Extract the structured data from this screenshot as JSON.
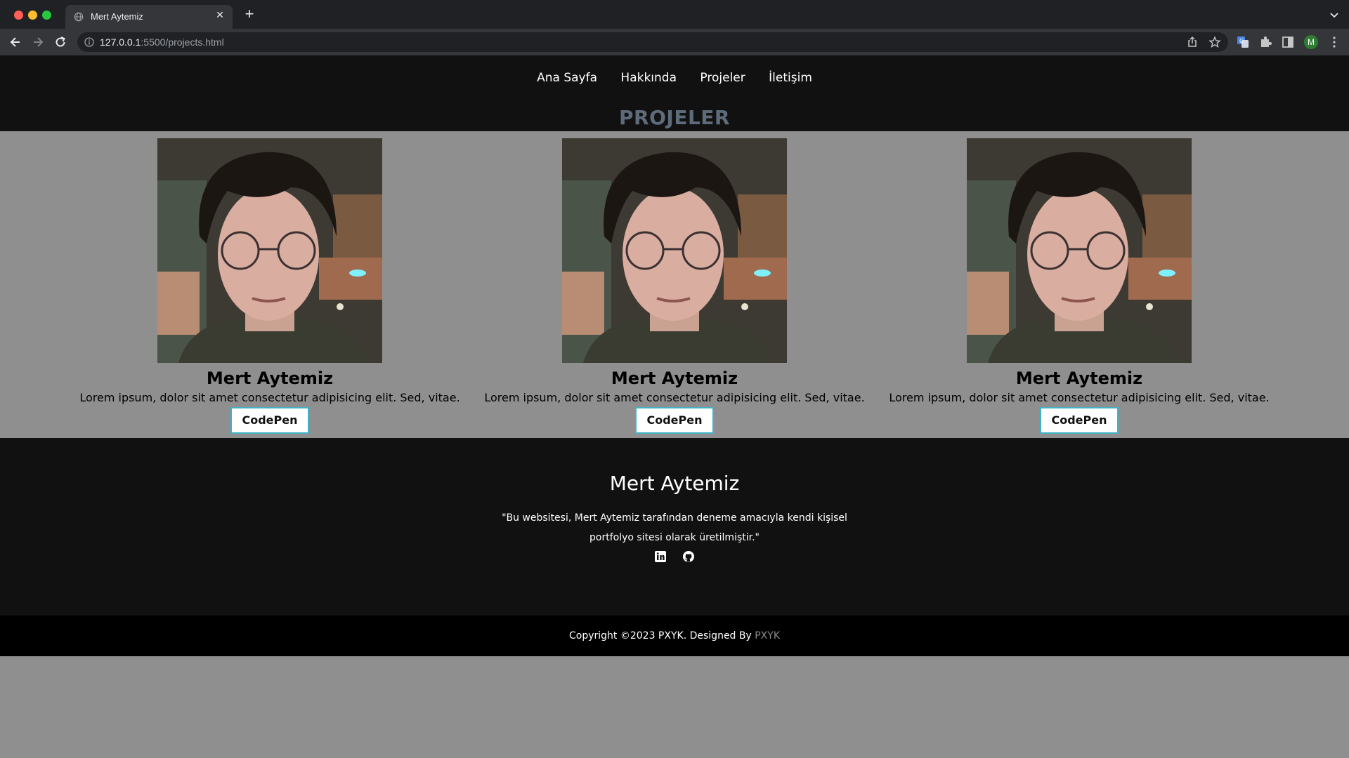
{
  "browser": {
    "tab_title": "Mert Aytemiz",
    "url_host": "127.0.0.1",
    "url_path": ":5500/projects.html",
    "avatar_letter": "M",
    "new_tab_symbol": "+",
    "close_symbol": "✕"
  },
  "site": {
    "nav": [
      "Ana Sayfa",
      "Hakkında",
      "Projeler",
      "İletişim"
    ],
    "page_title": "PROJELER",
    "projects": [
      {
        "title": "Mert Aytemiz",
        "text": "Lorem ipsum, dolor sit amet consectetur adipisicing elit. Sed, vitae.",
        "button": "CodePen"
      },
      {
        "title": "Mert Aytemiz",
        "text": "Lorem ipsum, dolor sit amet consectetur adipisicing elit. Sed, vitae.",
        "button": "CodePen"
      },
      {
        "title": "Mert Aytemiz",
        "text": "Lorem ipsum, dolor sit amet consectetur adipisicing elit. Sed, vitae.",
        "button": "CodePen"
      }
    ],
    "footer": {
      "name": "Mert Aytemiz",
      "description": "\"Bu websitesi, Mert Aytemiz tarafından deneme amacıyla kendi kişisel portfolyo sitesi olarak üretilmiştir.\"",
      "socials": [
        "linkedin-icon",
        "github-icon"
      ]
    },
    "copyright": {
      "text": "Copyright ©2023 PXYK. Designed By ",
      "brand": "PXYK"
    }
  },
  "colors": {
    "page_bg": "#8f8f8f",
    "header_bg": "#111111",
    "title_color": "#5d6b7a",
    "button_border": "#41b3c7",
    "brand_link": "#8a8a8a"
  }
}
